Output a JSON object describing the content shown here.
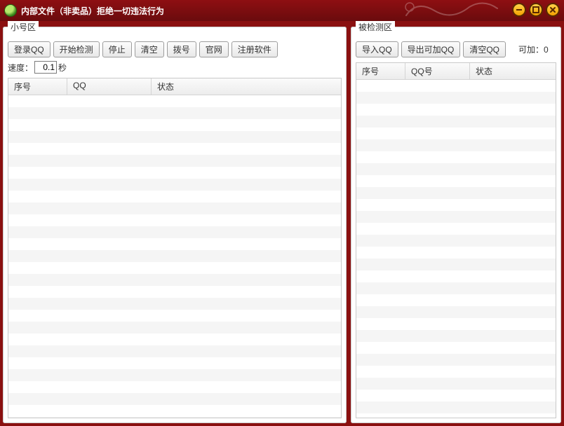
{
  "window": {
    "title": "内部文件（非卖品）拒绝一切违法行为"
  },
  "left": {
    "legend": "小号区",
    "buttons": {
      "login": "登录QQ",
      "start": "开始检测",
      "stop": "停止",
      "clear": "清空",
      "dial": "拨号",
      "site": "官网",
      "register": "注册软件"
    },
    "speed": {
      "label": "速度：",
      "value": "0.1",
      "unit": "秒"
    },
    "columns": {
      "c1": "序号",
      "c2": "QQ",
      "c3": "状态"
    },
    "rows": []
  },
  "right": {
    "legend": "被检测区",
    "buttons": {
      "import": "导入QQ",
      "exportAddable": "导出可加QQ",
      "clear": "清空QQ"
    },
    "addable": {
      "label": "可加：",
      "value": "0"
    },
    "columns": {
      "c1": "序号",
      "c2": "QQ号",
      "c3": "状态"
    },
    "rows": []
  }
}
